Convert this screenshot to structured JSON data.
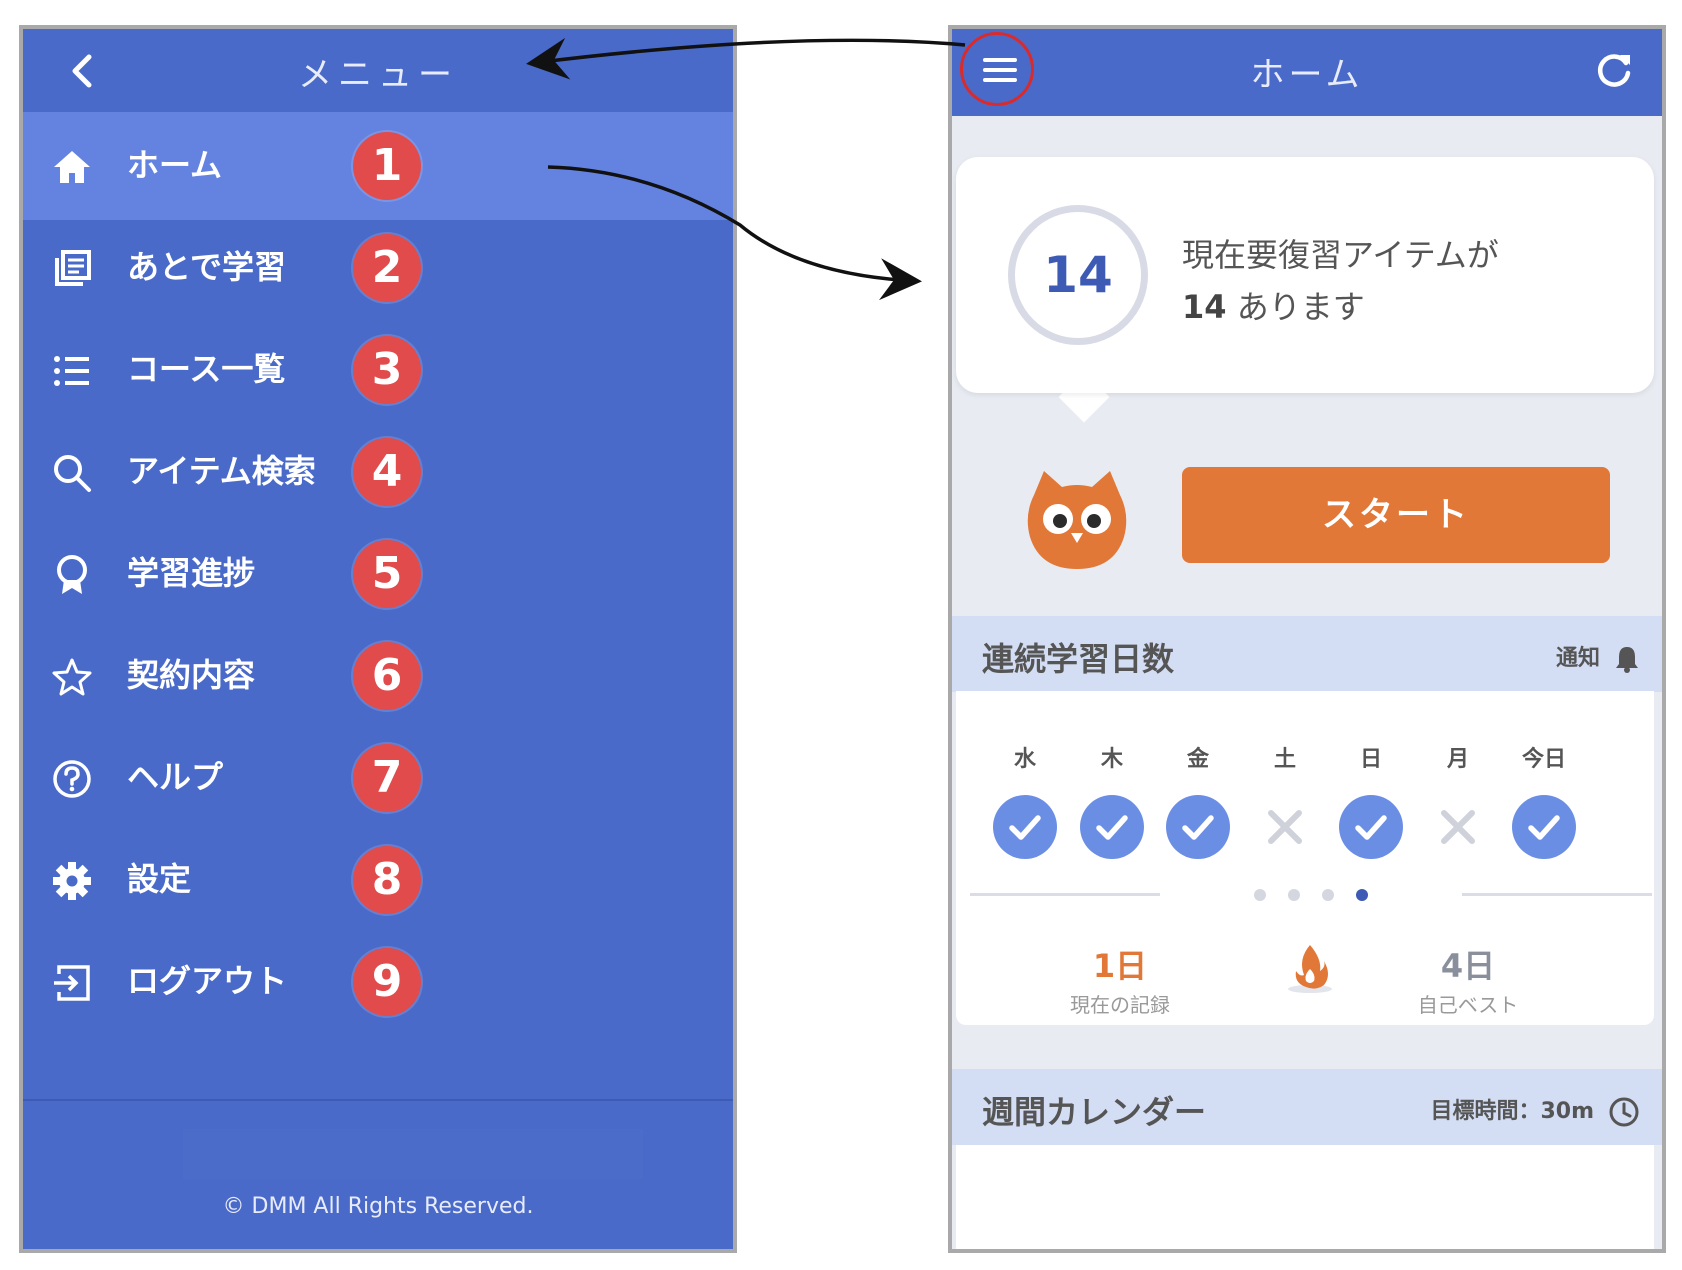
{
  "menu_screen": {
    "title": "メニュー",
    "items": [
      {
        "label": "ホーム",
        "icon": "home-icon",
        "badge": "1",
        "active": true
      },
      {
        "label": "あとで学習",
        "icon": "study-later-icon",
        "badge": "2"
      },
      {
        "label": "コース一覧",
        "icon": "list-icon",
        "badge": "3"
      },
      {
        "label": "アイテム検索",
        "icon": "search-icon",
        "badge": "4"
      },
      {
        "label": "学習進捗",
        "icon": "ribbon-icon",
        "badge": "5"
      },
      {
        "label": "契約内容",
        "icon": "star-icon",
        "badge": "6"
      },
      {
        "label": "ヘルプ",
        "icon": "help-icon",
        "badge": "7"
      },
      {
        "label": "設定",
        "icon": "gear-icon",
        "badge": "8"
      },
      {
        "label": "ログアウト",
        "icon": "logout-icon",
        "badge": "9"
      }
    ],
    "copyright": "© DMM All Rights Reserved."
  },
  "home_screen": {
    "title": "ホーム",
    "review": {
      "count": "14",
      "line1": "現在要復習アイテムが",
      "line2_count": "14",
      "line2_text": "あります"
    },
    "start_label": "スタート",
    "streak": {
      "title": "連続学習日数",
      "notify_label": "通知",
      "days": [
        {
          "label": "水",
          "done": true
        },
        {
          "label": "木",
          "done": true
        },
        {
          "label": "金",
          "done": true
        },
        {
          "label": "土",
          "done": false
        },
        {
          "label": "日",
          "done": true
        },
        {
          "label": "月",
          "done": false
        },
        {
          "label": "今日",
          "done": true
        }
      ],
      "pager_active_index": 3,
      "current_value": "1日",
      "current_label": "現在の記録",
      "best_value": "4日",
      "best_label": "自己ベスト"
    },
    "calendar": {
      "title": "週間カレンダー",
      "goal_label": "目標時間：30m"
    }
  },
  "colors": {
    "primary": "#4a6ac9",
    "active_item": "#6483e0",
    "badge": "#e14b4b",
    "start": "#e27837",
    "check": "#6b8ee5",
    "section_bg": "#d3ddf3"
  }
}
